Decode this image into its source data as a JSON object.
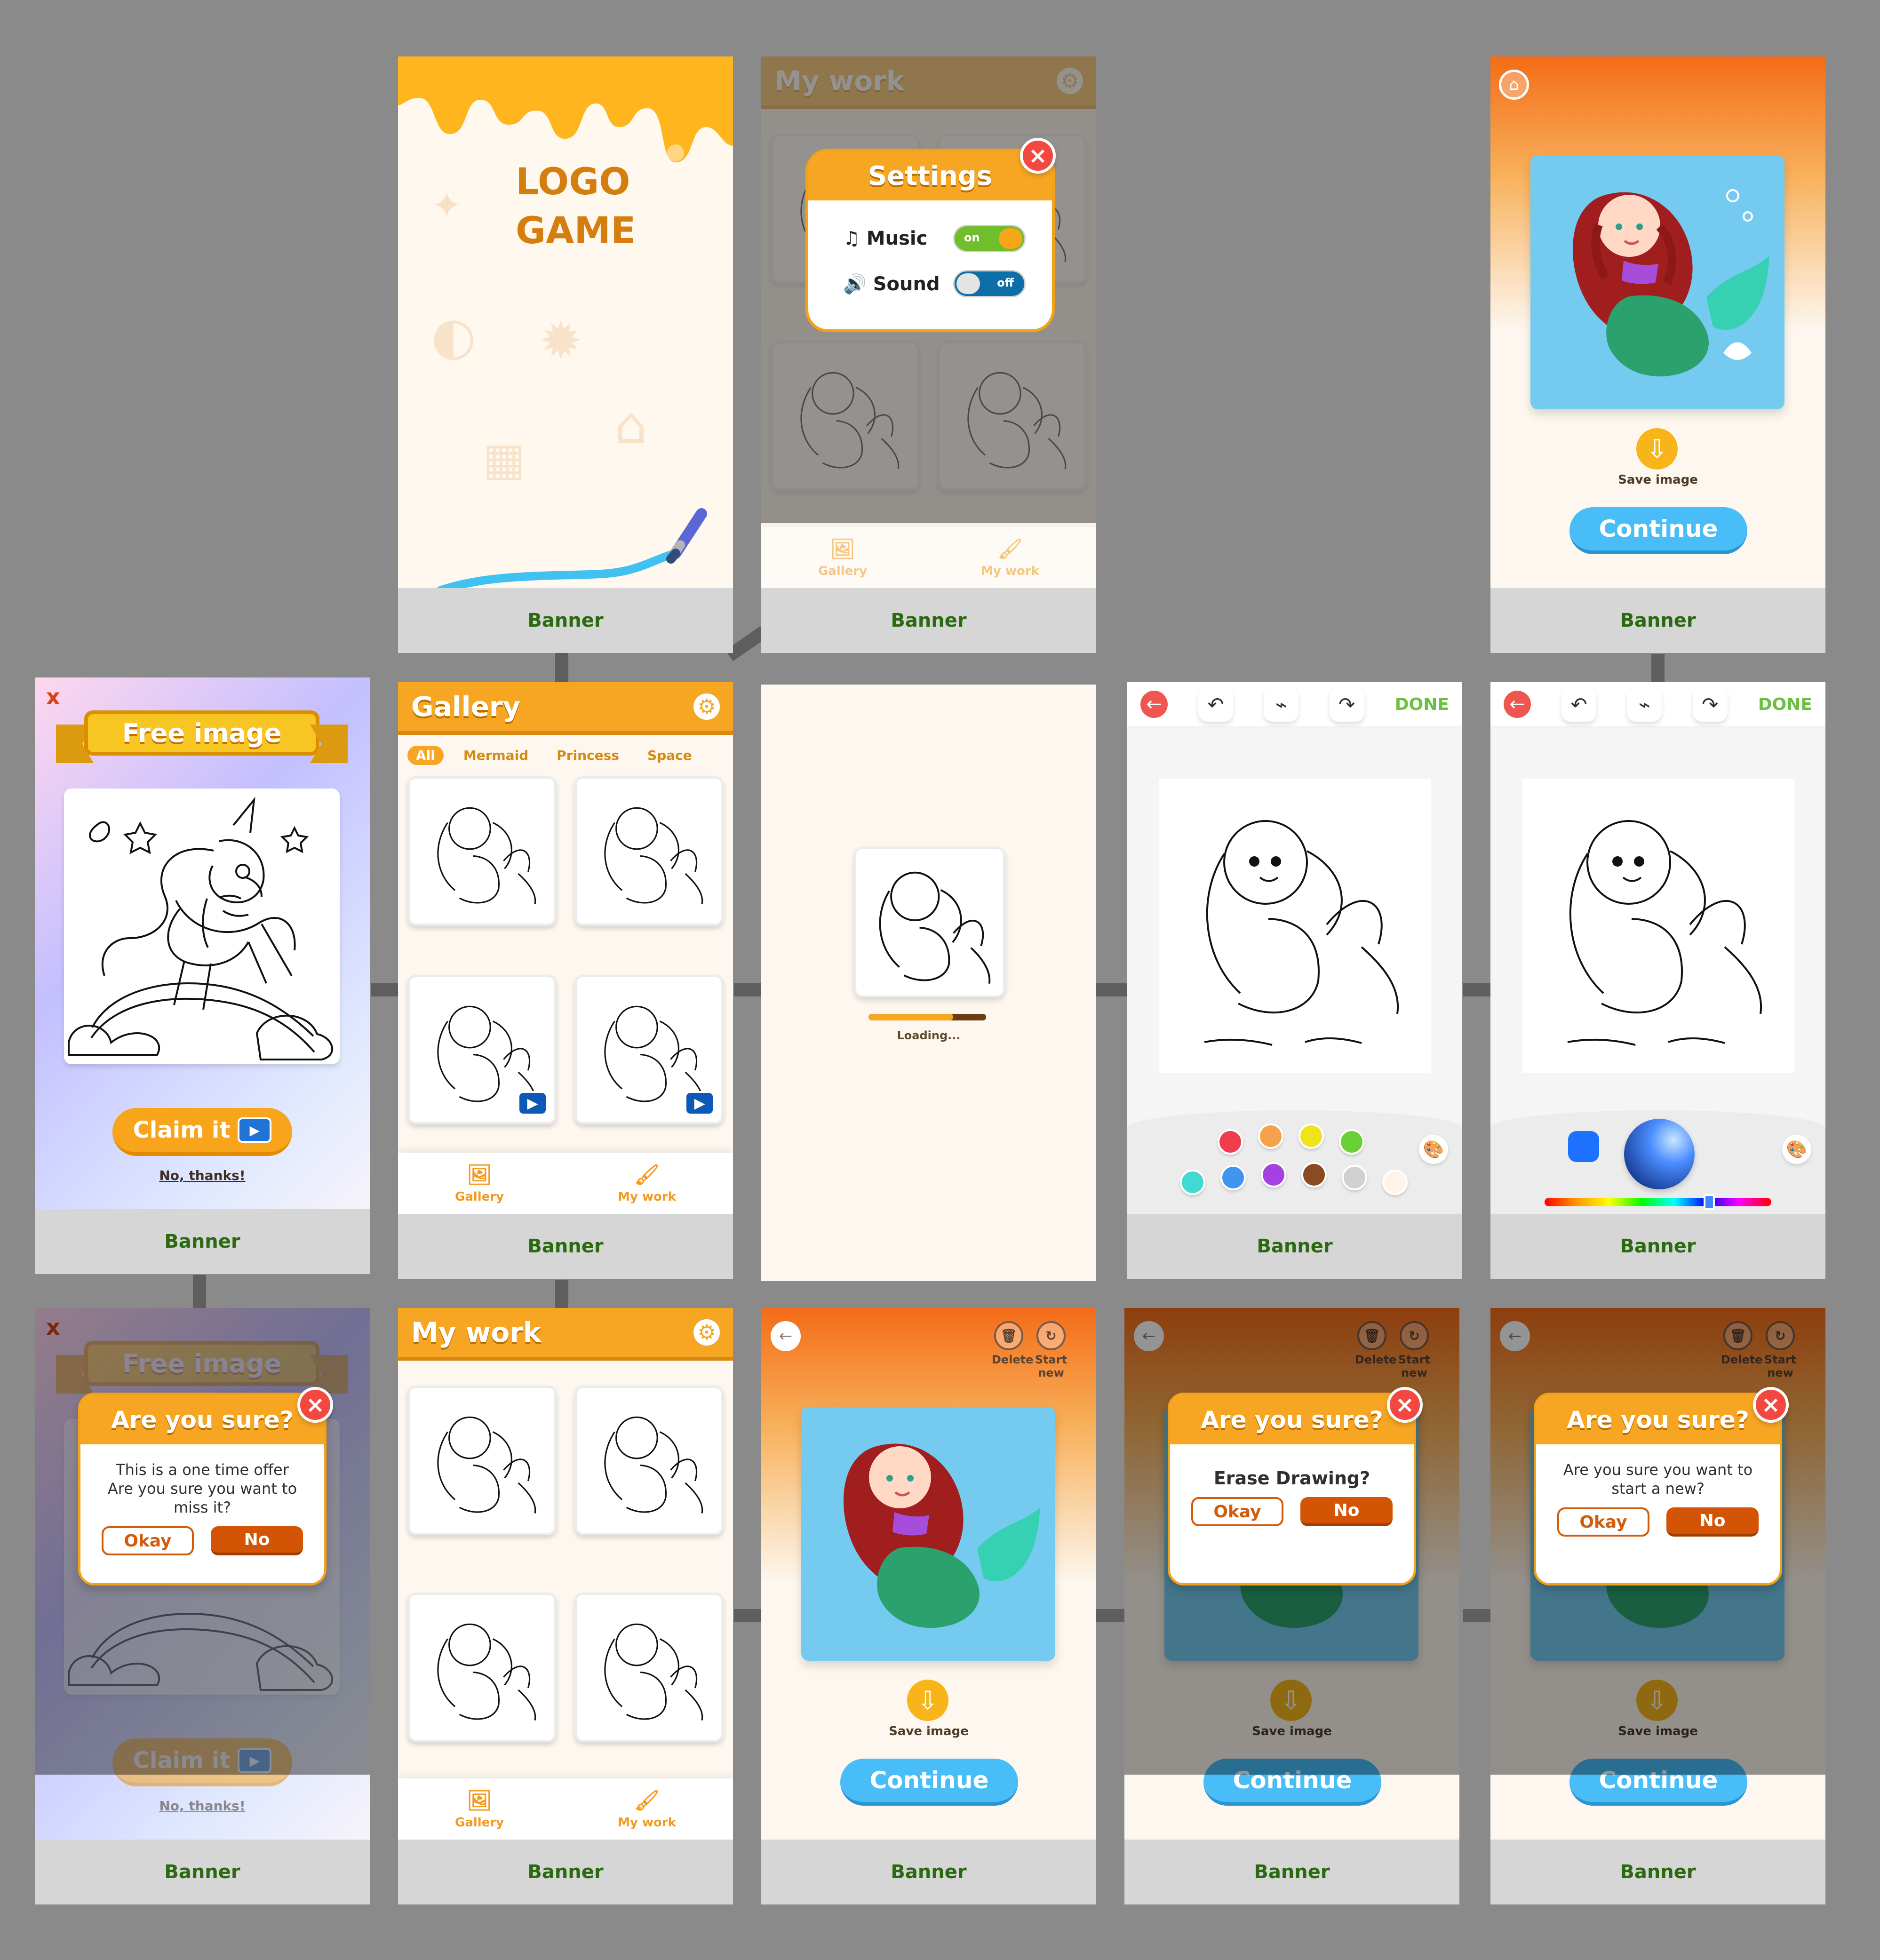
{
  "screens": {
    "logo": {
      "logo_text": [
        "LOGO",
        "GAME"
      ],
      "banner": "Banner"
    },
    "mywork_settings": {
      "header_title": "My work",
      "settings_title": "Settings",
      "music_label": "Music",
      "music_toggle": "on",
      "sound_label": "Sound",
      "sound_toggle": "off",
      "tabs": [
        "Gallery",
        "My work"
      ],
      "banner": "Banner"
    },
    "result_top": {
      "save_label": "Save image",
      "continue_label": "Continue",
      "banner": "Banner"
    },
    "free_image": {
      "close_label": "x",
      "title": "Free image",
      "claim_label": "Claim it",
      "no_thanks": "No, thanks!",
      "banner": "Banner"
    },
    "gallery": {
      "header_title": "Gallery",
      "chips": [
        "All",
        "Mermaid",
        "Princess",
        "Space"
      ],
      "tabs": [
        "Gallery",
        "My work"
      ],
      "banner": "Banner"
    },
    "loading": {
      "loading_text": "Loading..."
    },
    "draw_palette": {
      "done_label": "DONE",
      "banner": "Banner"
    },
    "draw_picker": {
      "done_label": "DONE",
      "banner": "Banner"
    },
    "free_confirm": {
      "close_label": "x",
      "title": "Free image",
      "dialog_title": "Are you sure?",
      "dialog_message_line1": "This is a one time offer",
      "dialog_message_line2": "Are you sure you want to miss it?",
      "okay_label": "Okay",
      "no_label": "No",
      "claim_label": "Claim it",
      "no_thanks": "No, thanks!",
      "banner": "Banner"
    },
    "mywork": {
      "header_title": "My work",
      "tabs": [
        "Gallery",
        "My work"
      ],
      "banner": "Banner"
    },
    "result_bottom": {
      "delete_label": "Delete",
      "start_label": "Start new",
      "save_label": "Save image",
      "continue_label": "Continue",
      "banner": "Banner"
    },
    "erase_confirm": {
      "delete_label": "Delete",
      "start_label": "Start new",
      "dialog_title": "Are you sure?",
      "dialog_message": "Erase Drawing?",
      "okay_label": "Okay",
      "no_label": "No",
      "save_label": "Save image",
      "continue_label": "Continue",
      "banner": "Banner"
    },
    "new_confirm": {
      "delete_label": "Delete",
      "start_label": "Start new",
      "dialog_title": "Are you sure?",
      "dialog_message_line1": "Are you sure you want to",
      "dialog_message_line2": "start a new?",
      "okay_label": "Okay",
      "no_label": "No",
      "save_label": "Save image",
      "continue_label": "Continue",
      "banner": "Banner"
    }
  },
  "colors": {
    "accent_orange": "#f6a623",
    "button_blue": "#48bdf8",
    "danger_red": "#f3473f",
    "banner_green": "#2c6a12",
    "swatches": [
      "#ef3d4d",
      "#f6a24a",
      "#f0e31d",
      "#6bcf36",
      "#42d9d3",
      "#4096ef",
      "#a540e2",
      "#8a4a22",
      "#d0d0d0",
      "#fff3ea"
    ]
  }
}
